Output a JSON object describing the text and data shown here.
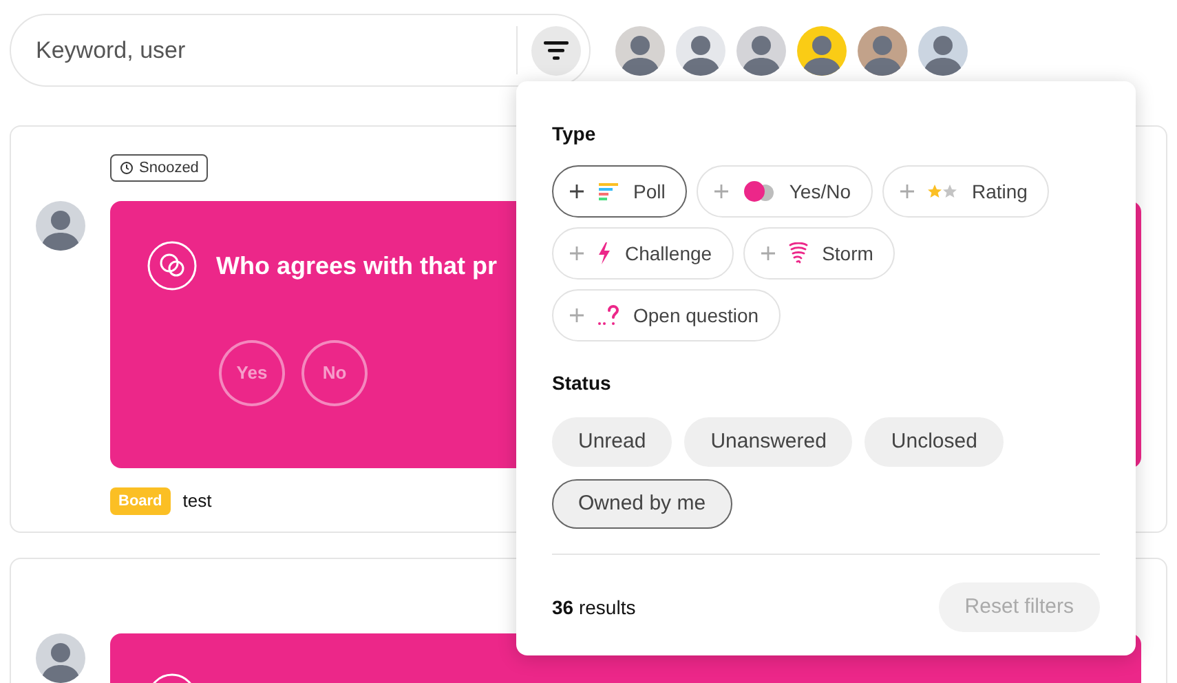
{
  "search": {
    "placeholder": "Keyword, user"
  },
  "cards": [
    {
      "tag": "Snoozed",
      "title": "Who agrees with that pr",
      "answers": [
        "Yes",
        "No"
      ],
      "board_tag": "Board",
      "board_name": "test"
    }
  ],
  "filter_popup": {
    "type_heading": "Type",
    "types": [
      {
        "kind": "poll",
        "label": "Poll",
        "selected": true
      },
      {
        "kind": "yesno",
        "label": "Yes/No",
        "selected": false
      },
      {
        "kind": "rating",
        "label": "Rating",
        "selected": false
      },
      {
        "kind": "challenge",
        "label": "Challenge",
        "selected": false
      },
      {
        "kind": "storm",
        "label": "Storm",
        "selected": false
      },
      {
        "kind": "open",
        "label": "Open question",
        "selected": false
      }
    ],
    "status_heading": "Status",
    "statuses": [
      {
        "label": "Unread",
        "selected": false
      },
      {
        "label": "Unanswered",
        "selected": false
      },
      {
        "label": "Unclosed",
        "selected": false
      },
      {
        "label": "Owned by me",
        "selected": true
      }
    ],
    "results": "**36** results",
    "reset": {
      "label": "Reset filters",
      "disabled": true
    }
  }
}
